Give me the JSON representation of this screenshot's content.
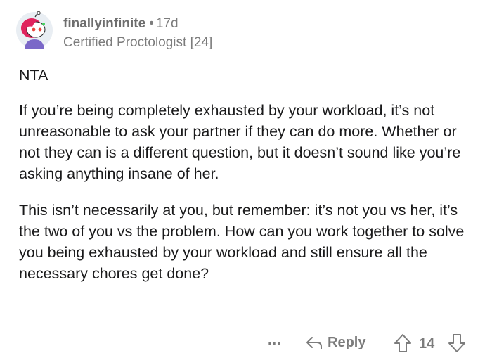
{
  "comment": {
    "username": "finallyinfinite",
    "separator": "•",
    "age": "17d",
    "flair": "Certified Proctologist [24]",
    "verdict": "NTA",
    "paragraphs": [
      "If you’re being completely exhausted by your workload, it’s not unreasonable to ask your partner if they can do more.  Whether or not they can is a different question, but it doesn’t sound like you’re asking anything insane of her.",
      "This isn’t necessarily at you, but remember: it’s not you vs her, it’s the two of you vs the problem.  How can you work together to solve you being exhausted by your workload and still ensure all the necessary chores get done?"
    ]
  },
  "actions": {
    "more_label": "...",
    "reply_label": "Reply",
    "score": "14"
  },
  "icons": {
    "avatar": "snoo-avatar-icon",
    "more": "more-options-icon",
    "reply": "reply-arrow-icon",
    "upvote": "upvote-arrow-icon",
    "downvote": "downvote-arrow-icon"
  },
  "colors": {
    "meta_text": "#7c7c7c",
    "body_text": "#1a1a1b",
    "avatar_hair": "#e0245e",
    "avatar_shirt": "#7b68c8"
  }
}
